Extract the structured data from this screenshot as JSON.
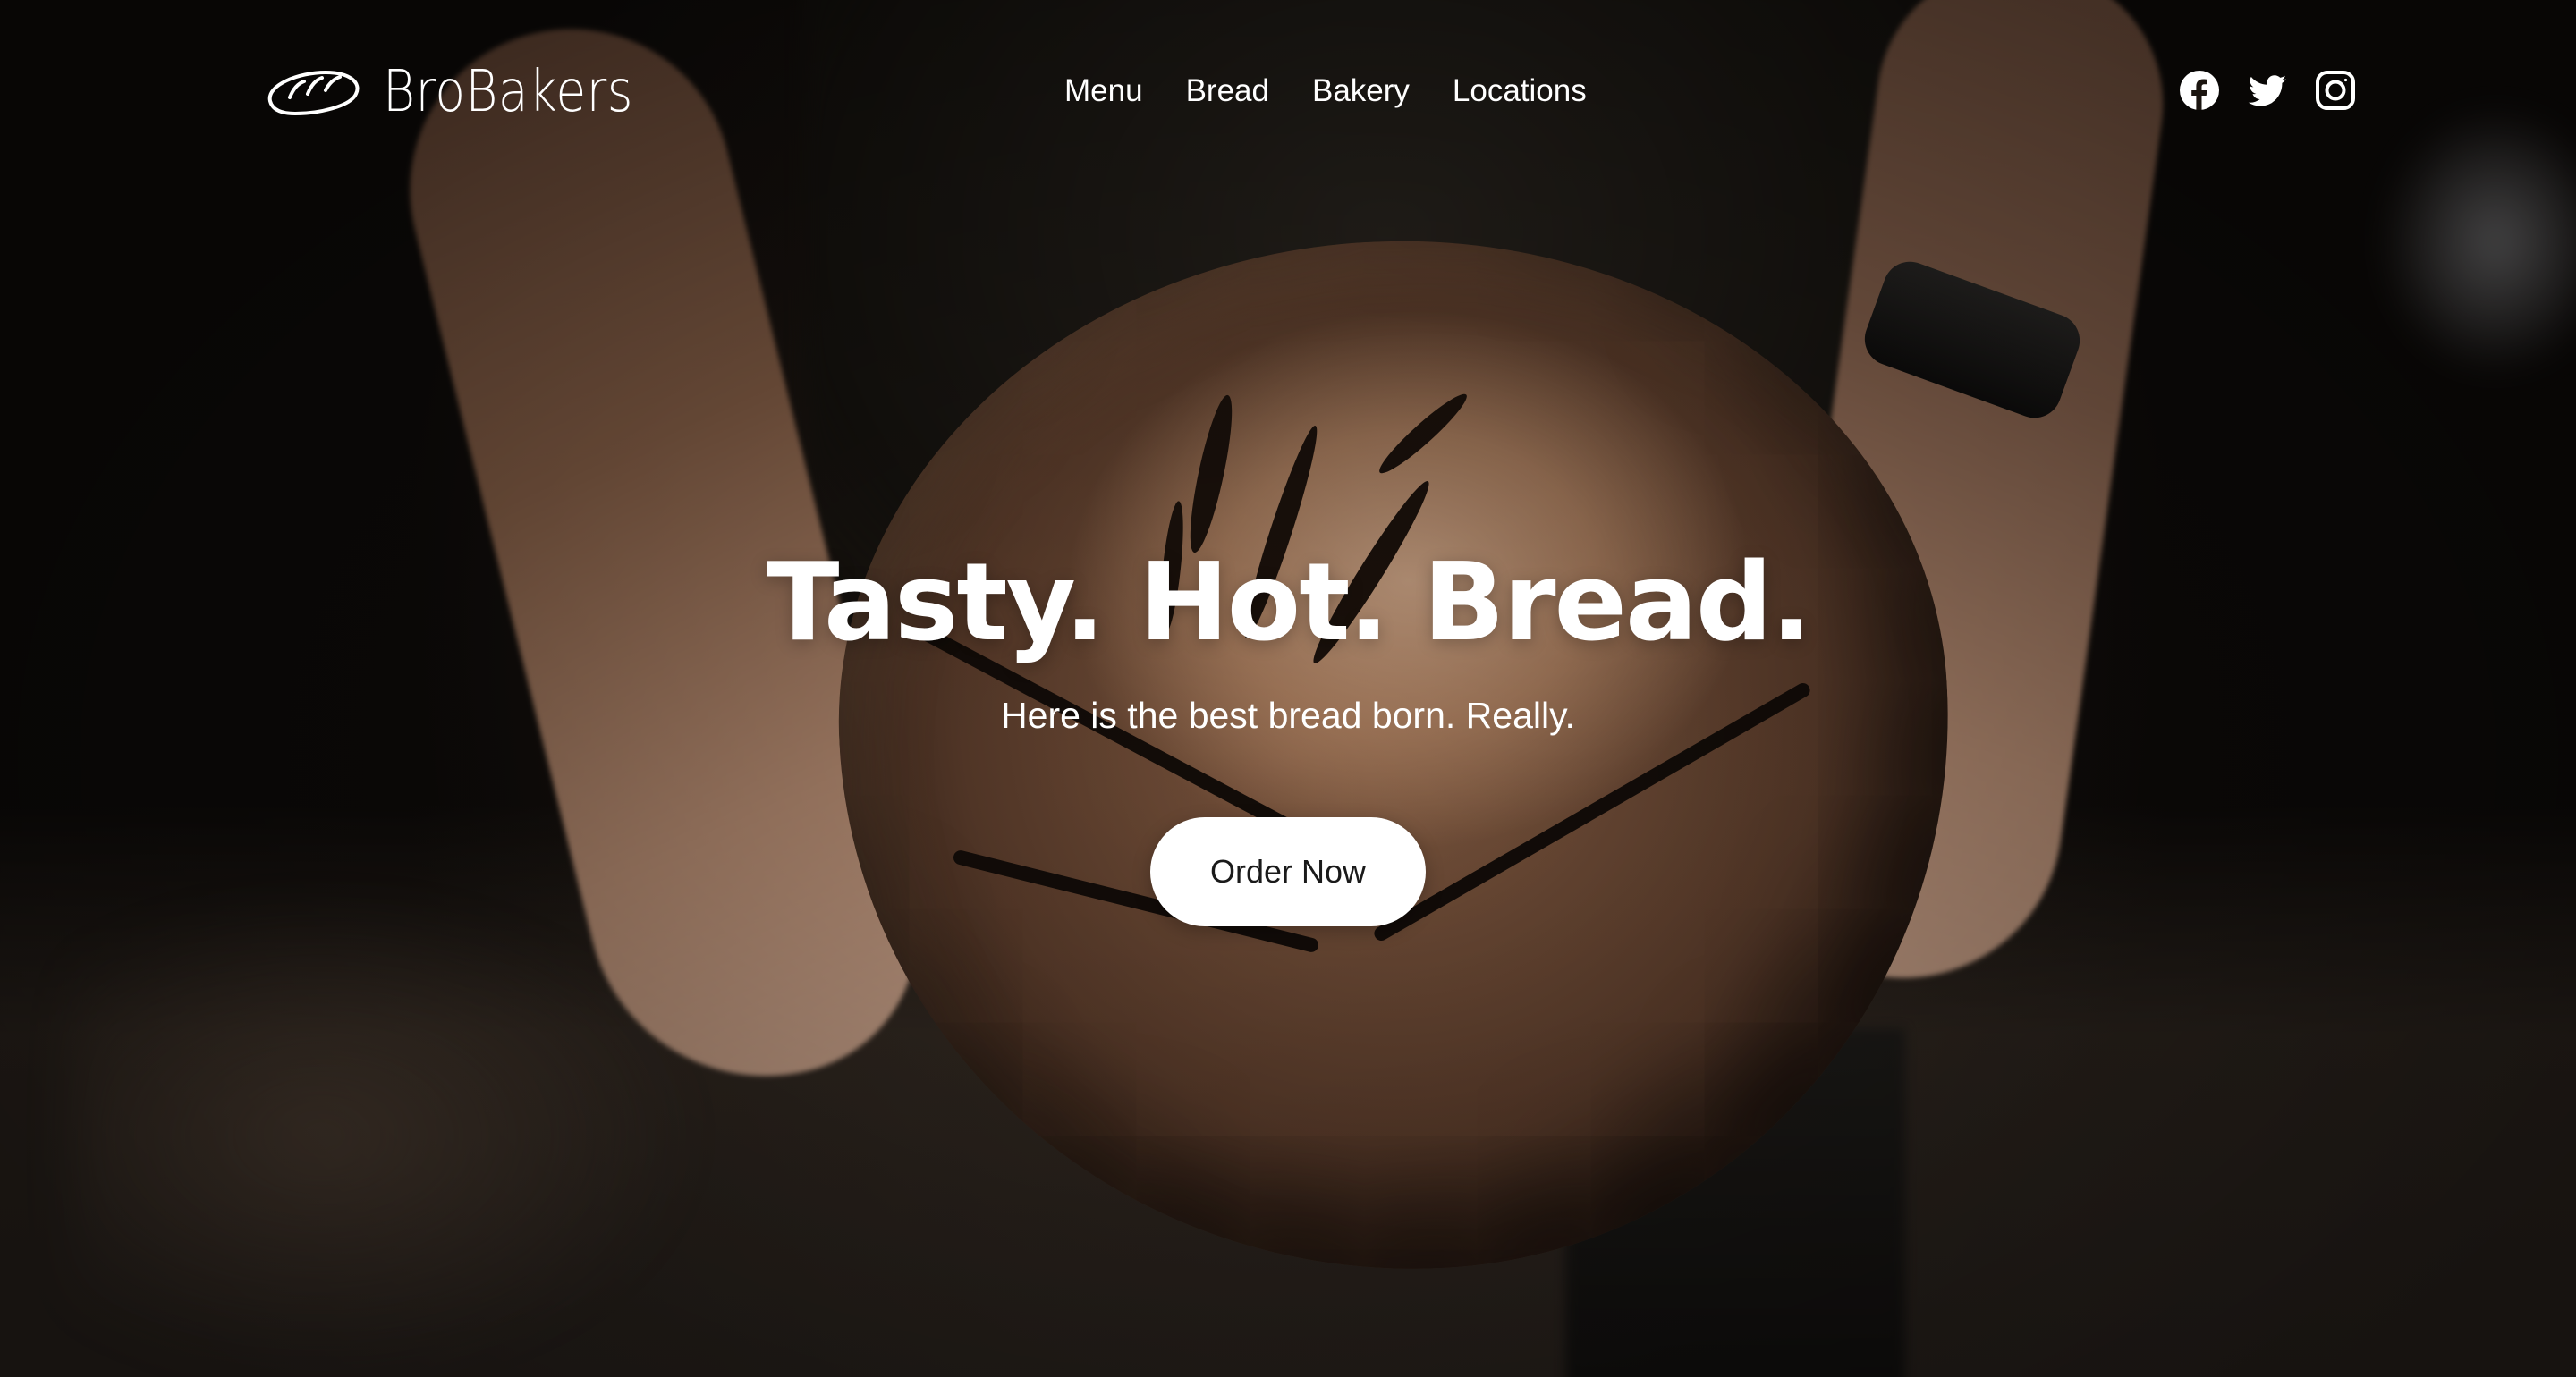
{
  "brand": {
    "name": "BroBakers"
  },
  "nav": {
    "items": [
      {
        "label": "Menu"
      },
      {
        "label": "Bread"
      },
      {
        "label": "Bakery"
      },
      {
        "label": "Locations"
      }
    ]
  },
  "social": {
    "icons": [
      "facebook-icon",
      "twitter-icon",
      "instagram-icon"
    ]
  },
  "hero": {
    "title": "Tasty. Hot. Bread.",
    "subtitle": "Here is the best bread born. Really.",
    "cta_label": "Order Now"
  },
  "colors": {
    "text": "#ffffff",
    "button_bg": "#ffffff",
    "button_text": "#1a1a1a"
  }
}
